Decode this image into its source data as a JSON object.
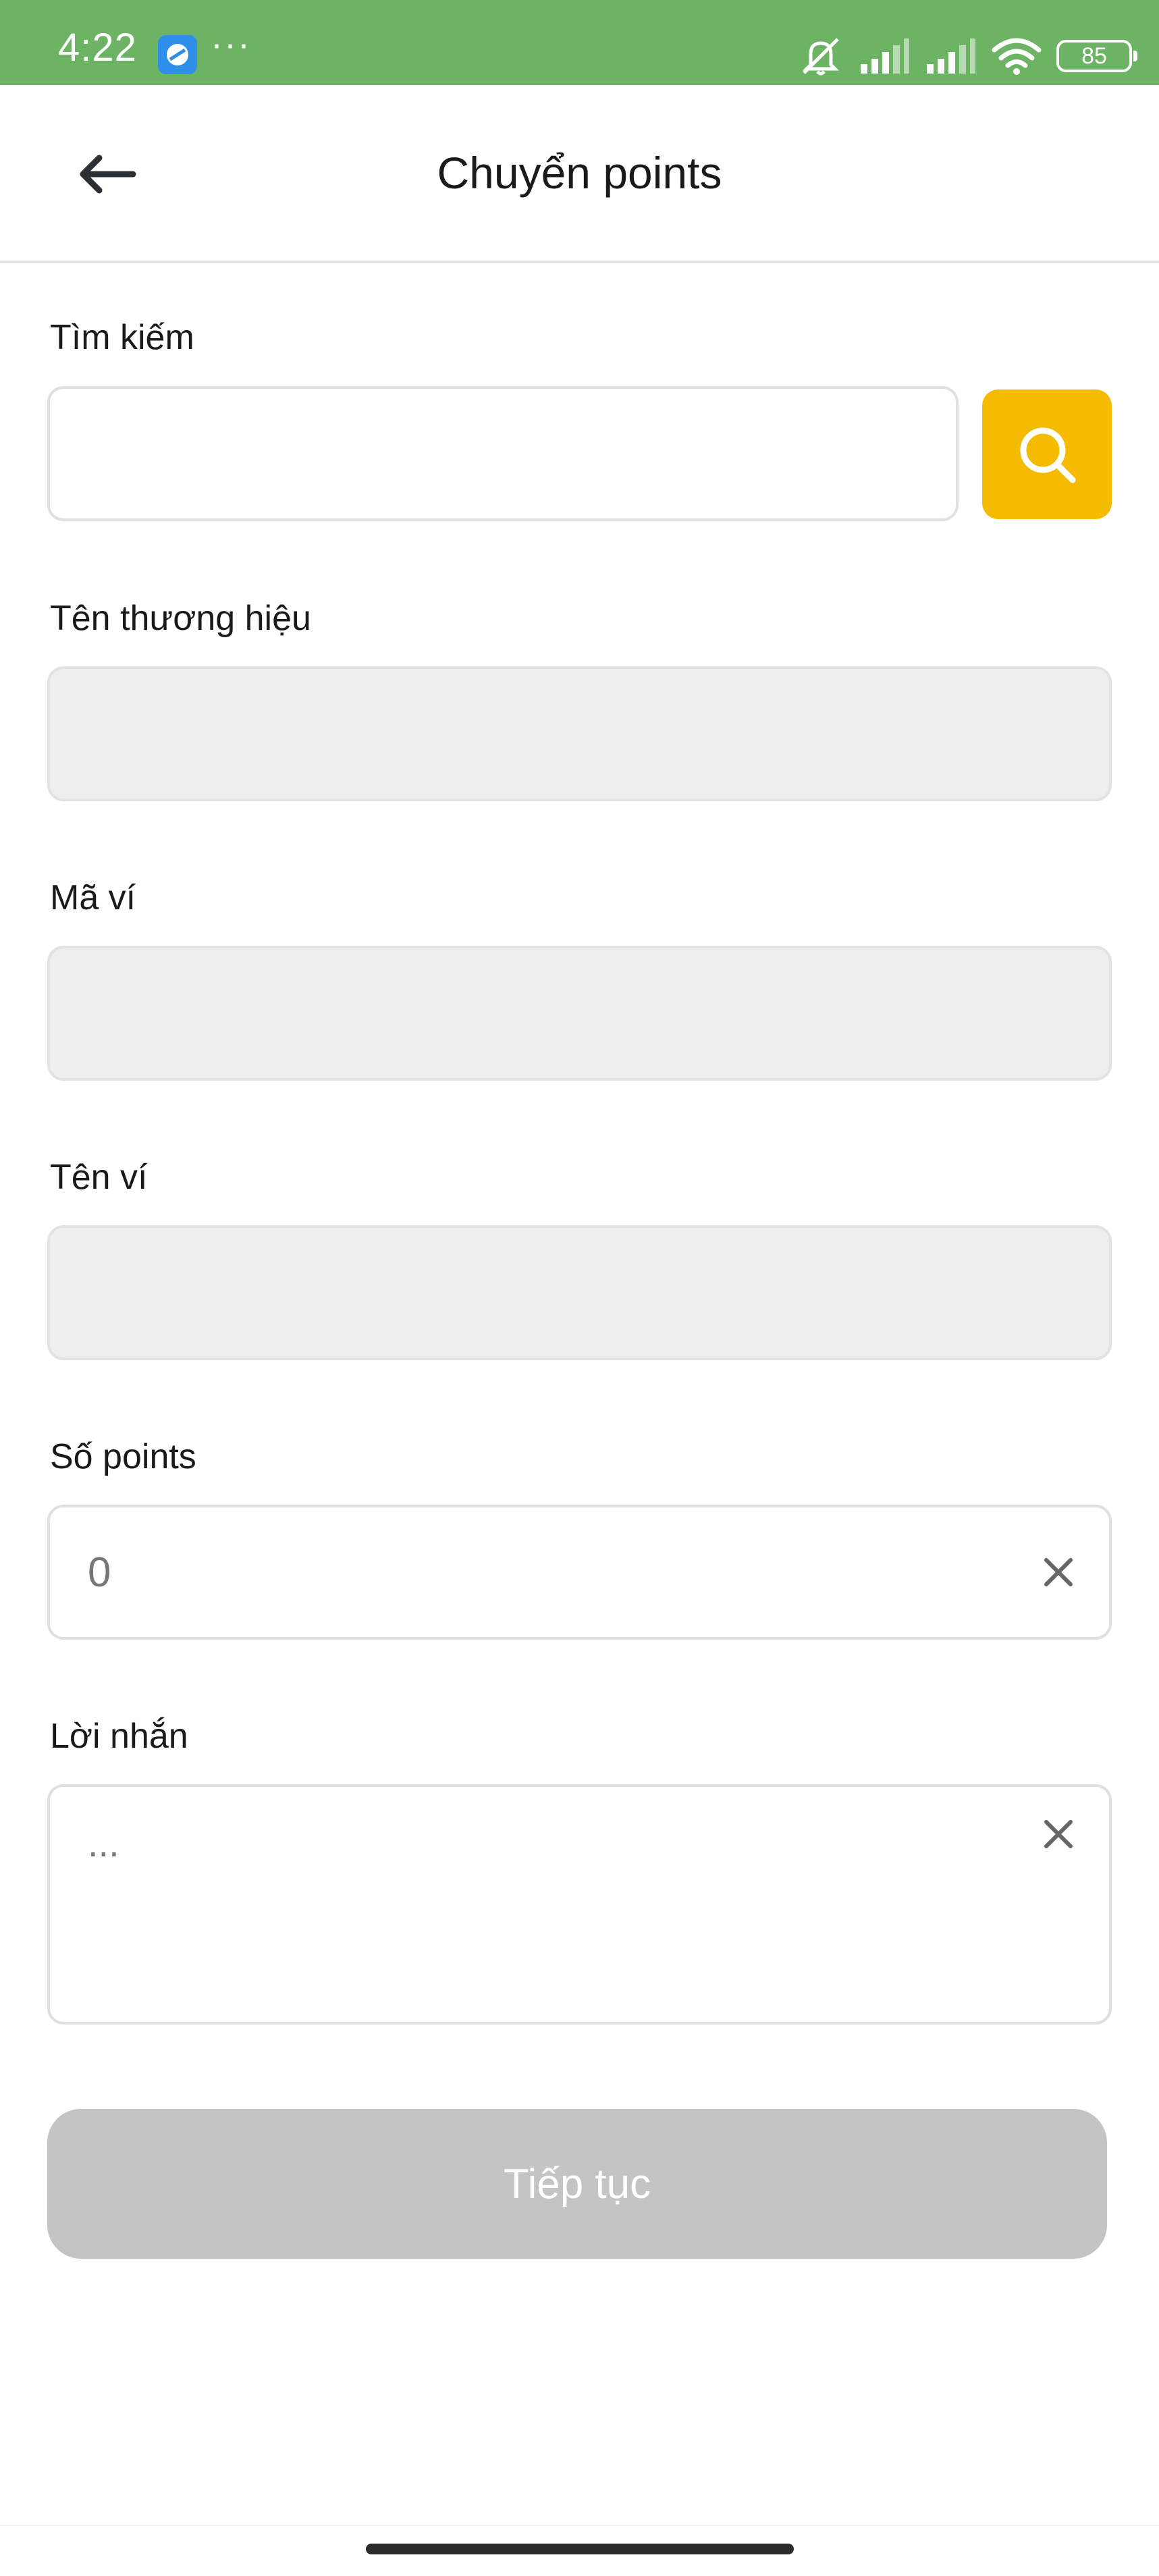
{
  "status_bar": {
    "time": "4:22",
    "notification_dots": "···",
    "battery_level": "85",
    "icons": [
      "app-notification-icon",
      "silent-mode-icon",
      "signal-icon",
      "signal-icon",
      "wifi-icon",
      "battery-icon"
    ]
  },
  "header": {
    "title": "Chuyển points",
    "back_icon": "arrow-left-icon"
  },
  "form": {
    "search": {
      "label": "Tìm kiếm",
      "value": "",
      "placeholder": "",
      "button_icon": "search-icon"
    },
    "brand_name": {
      "label": "Tên thương hiệu",
      "value": ""
    },
    "wallet_code": {
      "label": "Mã ví",
      "value": ""
    },
    "wallet_name": {
      "label": "Tên ví",
      "value": ""
    },
    "points": {
      "label": "Số points",
      "value": "",
      "placeholder": "0",
      "clear_icon": "close-icon"
    },
    "message": {
      "label": "Lời nhắn",
      "value": "",
      "placeholder": "...",
      "clear_icon": "close-icon"
    }
  },
  "actions": {
    "continue_label": "Tiếp tục",
    "continue_enabled": false
  },
  "colors": {
    "status_bar": "#6cb463",
    "search_button": "#f5bb00",
    "disabled_button": "#c4c4c4",
    "disabled_field": "#eeeeee"
  }
}
